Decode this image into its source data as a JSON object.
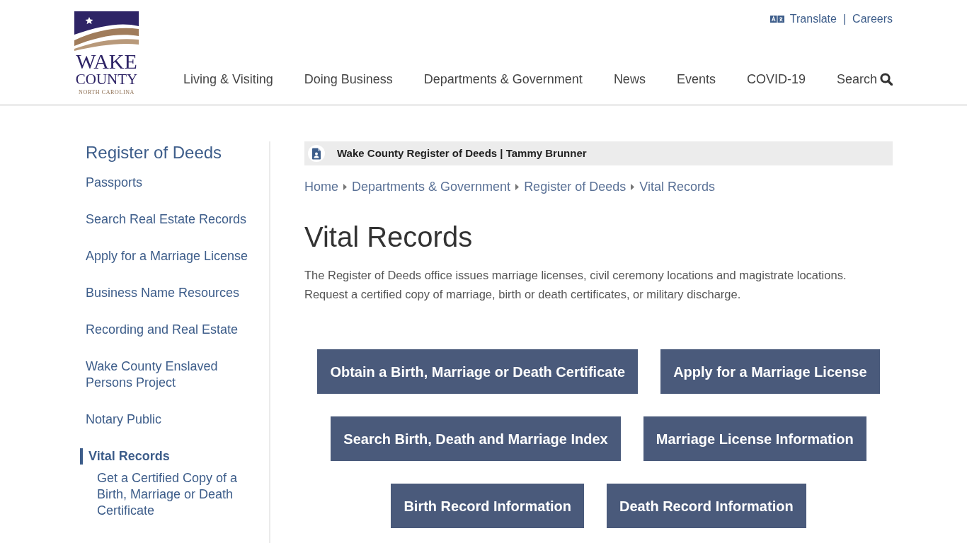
{
  "header": {
    "logo": {
      "line_1": "WAKE",
      "line_2": "COUNTY",
      "line_3": "NORTH CAROLINA"
    },
    "utility_links": [
      {
        "label": "Translate",
        "kind": "translate"
      },
      {
        "label": "Careers",
        "kind": "link"
      }
    ],
    "utility_separator": "|",
    "nav": [
      {
        "label": "Living & Visiting",
        "kind": "link"
      },
      {
        "label": "Doing Business",
        "kind": "link"
      },
      {
        "label": "Departments & Government",
        "kind": "link"
      },
      {
        "label": "News",
        "kind": "link"
      },
      {
        "label": "Events",
        "kind": "link"
      },
      {
        "label": "COVID-19",
        "kind": "link"
      },
      {
        "label": "Search",
        "kind": "search"
      }
    ]
  },
  "sidebar": {
    "title": "Register of Deeds",
    "items": [
      {
        "label": "Passports",
        "selected": false
      },
      {
        "label": "Search Real Estate Records",
        "selected": false
      },
      {
        "label": "Apply for a Marriage License",
        "selected": false
      },
      {
        "label": "Business Name Resources",
        "selected": false
      },
      {
        "label": "Recording and Real Estate",
        "selected": false
      },
      {
        "label": "Wake County Enslaved Persons Project",
        "selected": false
      },
      {
        "label": "Notary Public",
        "selected": false
      },
      {
        "label": "Vital Records",
        "selected": true,
        "children": [
          {
            "label": "Get a Certified Copy of a Birth, Marriage or Death Certificate",
            "selected": false
          }
        ]
      }
    ]
  },
  "banner": {
    "text": "Wake County Register of Deeds | Tammy Brunner"
  },
  "breadcrumb": [
    "Home",
    "Departments & Government",
    "Register of Deeds",
    "Vital Records"
  ],
  "heading": "Vital Records",
  "intro": "The Register of Deeds office issues marriage licenses, civil ceremony locations and magistrate locations. Request a certified copy of marriage, birth or death certificates, or military discharge.",
  "button_rows": [
    [
      "Obtain a Birth, Marriage or Death Certificate",
      "Apply for a Marriage License"
    ],
    [
      "Search Birth, Death and Marriage Index",
      "Marriage License Information"
    ],
    [
      "Birth Record Information",
      "Death Record Information"
    ]
  ]
}
